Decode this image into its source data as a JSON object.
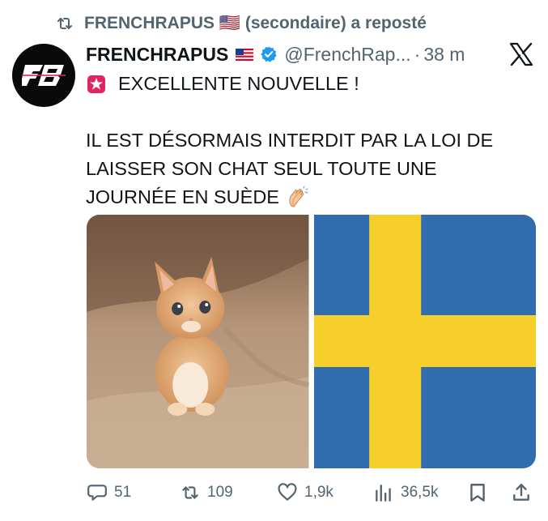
{
  "repost": {
    "label": "FRENCHRAPUS 🇺🇸 (secondaire) a reposté",
    "icon": "repost-icon"
  },
  "author": {
    "name": "FRENCHRAPUS",
    "flag": "us-flag-icon",
    "verified": "verified-badge-icon",
    "handle": "@FrenchRap...",
    "separator": "·",
    "time": "38 m"
  },
  "platform_logo": "x-logo-icon",
  "tweet": {
    "line1": "EXCELLENTE NOUVELLE !",
    "line2": "IL EST DÉSORMAIS INTERDIT PAR LA LOI DE",
    "line3": "LAISSER SON CHAT SEUL TOUTE UNE",
    "line4": "JOURNÉE EN SUÈDE",
    "emoji_start": "siren-icon",
    "emoji_end": "clapping-hands-icon"
  },
  "media": [
    {
      "name": "kitten-photo",
      "description_icon": "kitten-image"
    },
    {
      "name": "sweden-flag-image",
      "colors": {
        "blue": "#316cae",
        "yellow": "#f7cf2b"
      }
    }
  ],
  "actions": {
    "replies": "51",
    "reposts": "109",
    "likes": "1,9k",
    "views": "36,5k"
  },
  "colors": {
    "secondary_text": "#536471",
    "primary_text": "#0f1419",
    "verified_blue": "#1d9bf0"
  }
}
